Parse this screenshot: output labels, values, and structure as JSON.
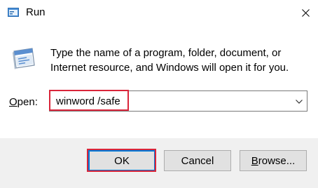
{
  "window": {
    "title": "Run",
    "app_icon": "run-icon",
    "close_icon": "close-icon"
  },
  "dialog": {
    "prompt_icon": "run-program-icon",
    "description": "Type the name of a program, folder, document, or Internet resource, and Windows will open it for you.",
    "open_label_accel": "O",
    "open_label_rest": "pen:",
    "input_value": "winword /safe",
    "dropdown_icon": "chevron-down-icon"
  },
  "buttons": {
    "ok": "OK",
    "cancel": "Cancel",
    "browse_accel": "B",
    "browse_rest": "rowse..."
  },
  "colors": {
    "highlight": "#d9253a",
    "accent": "#0078d7",
    "footer_bg": "#f0f0f0"
  }
}
